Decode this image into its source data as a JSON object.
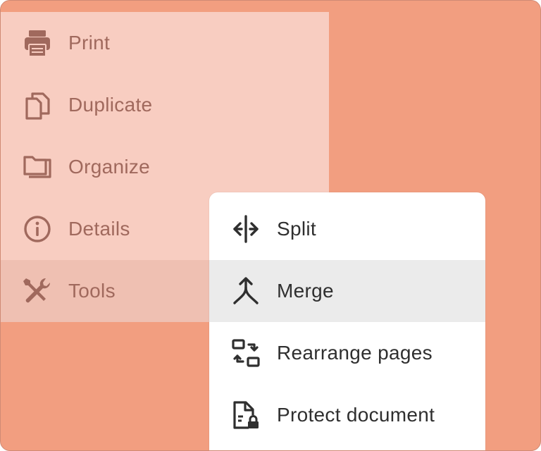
{
  "menu": {
    "items": [
      {
        "label": "Print",
        "icon": "printer-icon"
      },
      {
        "label": "Duplicate",
        "icon": "duplicate-icon"
      },
      {
        "label": "Organize",
        "icon": "folders-icon"
      },
      {
        "label": "Details",
        "icon": "info-icon"
      },
      {
        "label": "Tools",
        "icon": "tools-icon",
        "active": true
      }
    ]
  },
  "submenu": {
    "items": [
      {
        "label": "Split",
        "icon": "split-icon"
      },
      {
        "label": "Merge",
        "icon": "merge-icon",
        "highlighted": true
      },
      {
        "label": "Rearrange pages",
        "icon": "rearrange-icon"
      },
      {
        "label": "Protect document",
        "icon": "lock-document-icon"
      }
    ]
  },
  "colors": {
    "background": "#f29e80",
    "menu_background": "#f8cdc1",
    "menu_active": "#efc0b2",
    "menu_text": "#a0695d",
    "submenu_background": "#ffffff",
    "submenu_highlight": "#ebebeb",
    "submenu_text": "#2f2f2f"
  }
}
